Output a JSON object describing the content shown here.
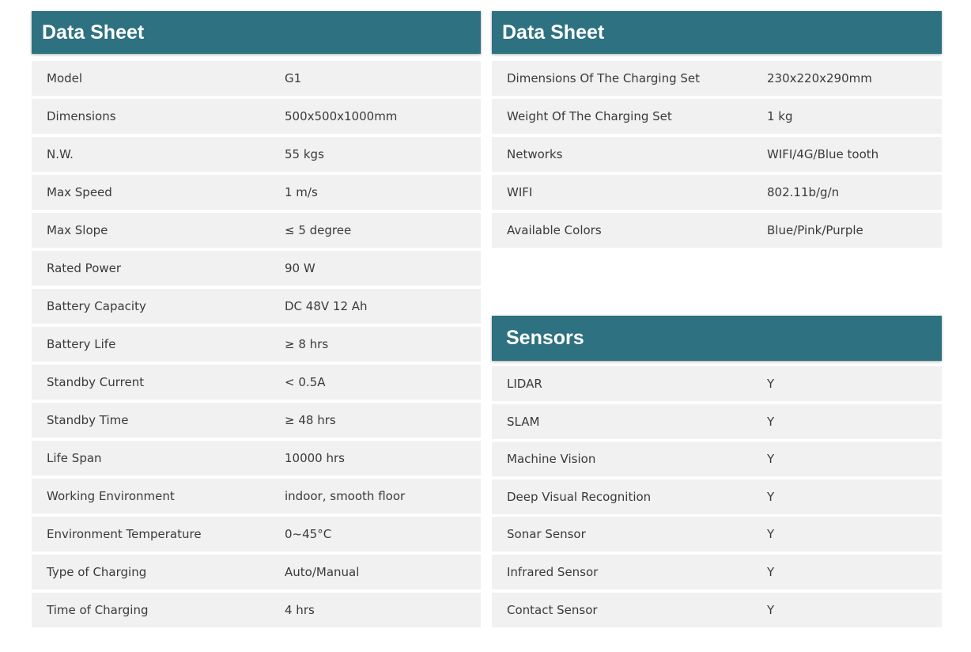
{
  "left_panel": {
    "title": "Data Sheet",
    "rows": [
      {
        "label": "Model",
        "value": "G1"
      },
      {
        "label": "Dimensions",
        "value": "500x500x1000mm"
      },
      {
        "label": "N.W.",
        "value": "55 kgs"
      },
      {
        "label": "Max Speed",
        "value": "1 m/s"
      },
      {
        "label": "Max Slope",
        "value": "≤ 5 degree"
      },
      {
        "label": "Rated Power",
        "value": "90 W"
      },
      {
        "label": "Battery Capacity",
        "value": "DC 48V 12 Ah"
      },
      {
        "label": "Battery Life",
        "value": "≥ 8 hrs"
      },
      {
        "label": "Standby Current",
        "value": "< 0.5A"
      },
      {
        "label": "Standby Time",
        "value": "≥ 48 hrs"
      },
      {
        "label": "Life Span",
        "value": "10000 hrs"
      },
      {
        "label": "Working Environment",
        "value": "indoor, smooth floor"
      },
      {
        "label": "Environment Temperature",
        "value": "0~45°C"
      },
      {
        "label": "Type of Charging",
        "value": "Auto/Manual"
      },
      {
        "label": "Time of Charging",
        "value": "4 hrs"
      }
    ]
  },
  "right_panel": {
    "title": "Data Sheet",
    "rows": [
      {
        "label": "Dimensions Of The Charging Set",
        "value": "230x220x290mm"
      },
      {
        "label": "Weight Of The Charging Set",
        "value": "1 kg"
      },
      {
        "label": "Networks",
        "value": "WIFI/4G/Blue tooth"
      },
      {
        "label": "WIFI",
        "value": "802.11b/g/n"
      },
      {
        "label": "Available Colors",
        "value": "Blue/Pink/Purple"
      }
    ]
  },
  "sensors_panel": {
    "title": "Sensors",
    "rows": [
      {
        "label": "LIDAR",
        "value": "Y"
      },
      {
        "label": "SLAM",
        "value": "Y"
      },
      {
        "label": "Machine Vision",
        "value": "Y"
      },
      {
        "label": "Deep Visual Recognition",
        "value": "Y"
      },
      {
        "label": "Sonar Sensor",
        "value": "Y"
      },
      {
        "label": "Infrared Sensor",
        "value": "Y"
      },
      {
        "label": "Contact Sensor",
        "value": "Y"
      }
    ]
  },
  "colors": {
    "header_bg": "#2e7181",
    "row_bg": "#f1f1f1"
  }
}
